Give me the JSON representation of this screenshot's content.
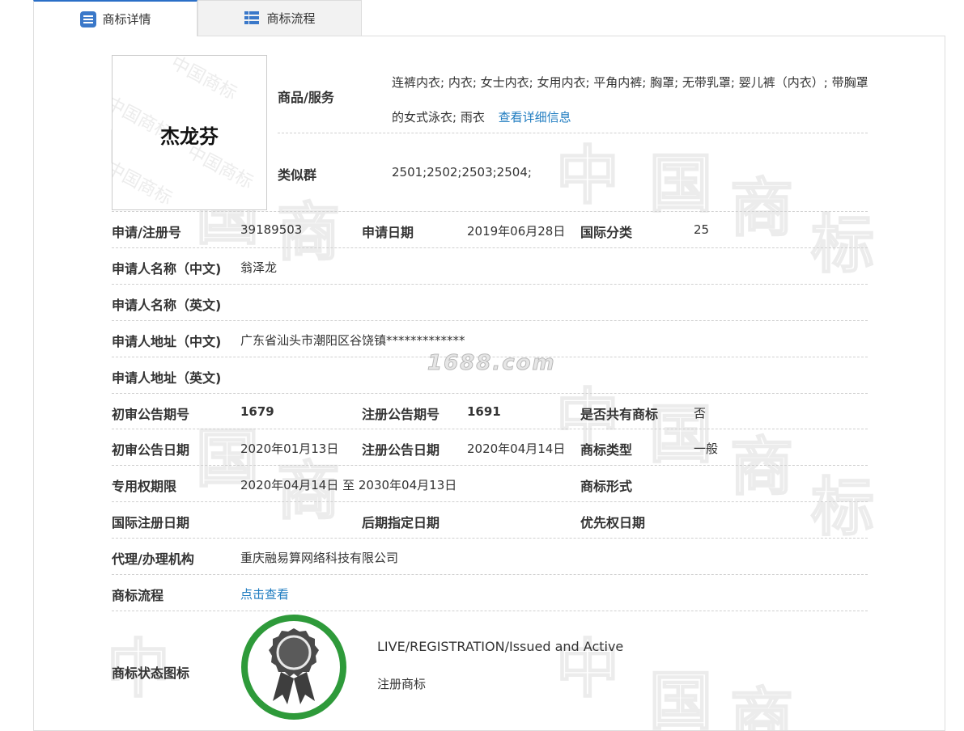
{
  "tabs": [
    {
      "label": "商标详情",
      "icon": "list-icon",
      "active": true
    },
    {
      "label": "商标流程",
      "icon": "grid-icon",
      "active": false
    }
  ],
  "watermark": {
    "text": "1688.com",
    "bg_text": [
      "中",
      "国",
      "商",
      "标"
    ]
  },
  "trademark": {
    "image_text": "杰龙芬",
    "goods_label": "商品/服务",
    "goods_value": "连裤内衣; 内衣; 女士内衣; 女用内衣; 平角内裤; 胸罩; 无带乳罩; 婴儿裤（内衣）; 带胸罩的女式泳衣; 雨衣",
    "goods_link": "查看详细信息",
    "similar_label": "类似群",
    "similar_value": "2501;2502;2503;2504;"
  },
  "rows": {
    "reg_no_label": "申请/注册号",
    "reg_no": "39189503",
    "apply_date_label": "申请日期",
    "apply_date": "2019年06月28日",
    "intl_class_label": "国际分类",
    "intl_class": "25",
    "applicant_cn_label": "申请人名称（中文)",
    "applicant_cn": "翁泽龙",
    "applicant_en_label": "申请人名称（英文)",
    "applicant_en": "",
    "address_cn_label": "申请人地址（中文)",
    "address_cn": "广东省汕头市潮阳区谷饶镇*************",
    "address_en_label": "申请人地址（英文)",
    "address_en": "",
    "prelim_no_label": "初审公告期号",
    "prelim_no": "1679",
    "reg_pub_no_label": "注册公告期号",
    "reg_pub_no": "1691",
    "shared_label": "是否共有商标",
    "shared": "否",
    "prelim_date_label": "初审公告日期",
    "prelim_date": "2020年01月13日",
    "reg_pub_date_label": "注册公告日期",
    "reg_pub_date": "2020年04月14日",
    "type_label": "商标类型",
    "type": "一般",
    "exclusive_label": "专用权期限",
    "exclusive": "2020年04月14日 至 2030年04月13日",
    "form_label": "商标形式",
    "form": "",
    "intl_reg_label": "国际注册日期",
    "intl_reg": "",
    "later_label": "后期指定日期",
    "later": "",
    "priority_label": "优先权日期",
    "priority": "",
    "agent_label": "代理/办理机构",
    "agent": "重庆融易算网络科技有限公司",
    "flow_label": "商标流程",
    "flow_link": "点击查看",
    "status_label": "商标状态图标",
    "status_en": "LIVE/REGISTRATION/Issued and Active",
    "status_cn": "注册商标"
  },
  "colors": {
    "accent": "#2a6fc7",
    "link": "#1f7cc0",
    "badge_ring": "#2e9a3a",
    "badge_seal": "#4a4a4a"
  }
}
